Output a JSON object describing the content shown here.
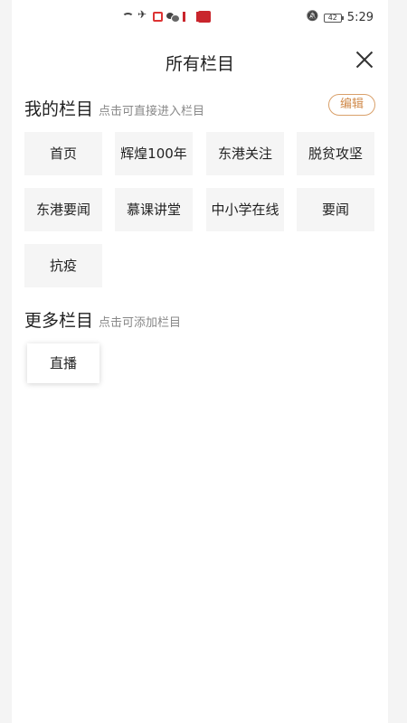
{
  "status_bar": {
    "battery": "42",
    "time": "5:29"
  },
  "header": {
    "title": "所有栏目"
  },
  "my_channels": {
    "title": "我的栏目",
    "hint": "点击可直接进入栏目",
    "edit_label": "编辑",
    "items": [
      {
        "label": "首页"
      },
      {
        "label": "辉煌100年"
      },
      {
        "label": "东港关注"
      },
      {
        "label": "脱贫攻坚"
      },
      {
        "label": "东港要闻"
      },
      {
        "label": "慕课讲堂"
      },
      {
        "label": "中小学在线"
      },
      {
        "label": "要闻"
      },
      {
        "label": "抗疫"
      }
    ]
  },
  "more_channels": {
    "title": "更多栏目",
    "hint": "点击可添加栏目",
    "items": [
      {
        "label": "直播"
      }
    ]
  },
  "colors": {
    "accent": "#d08a4a",
    "chip_bg": "#f5f5f5",
    "page_bg": "#f4f4f4"
  }
}
